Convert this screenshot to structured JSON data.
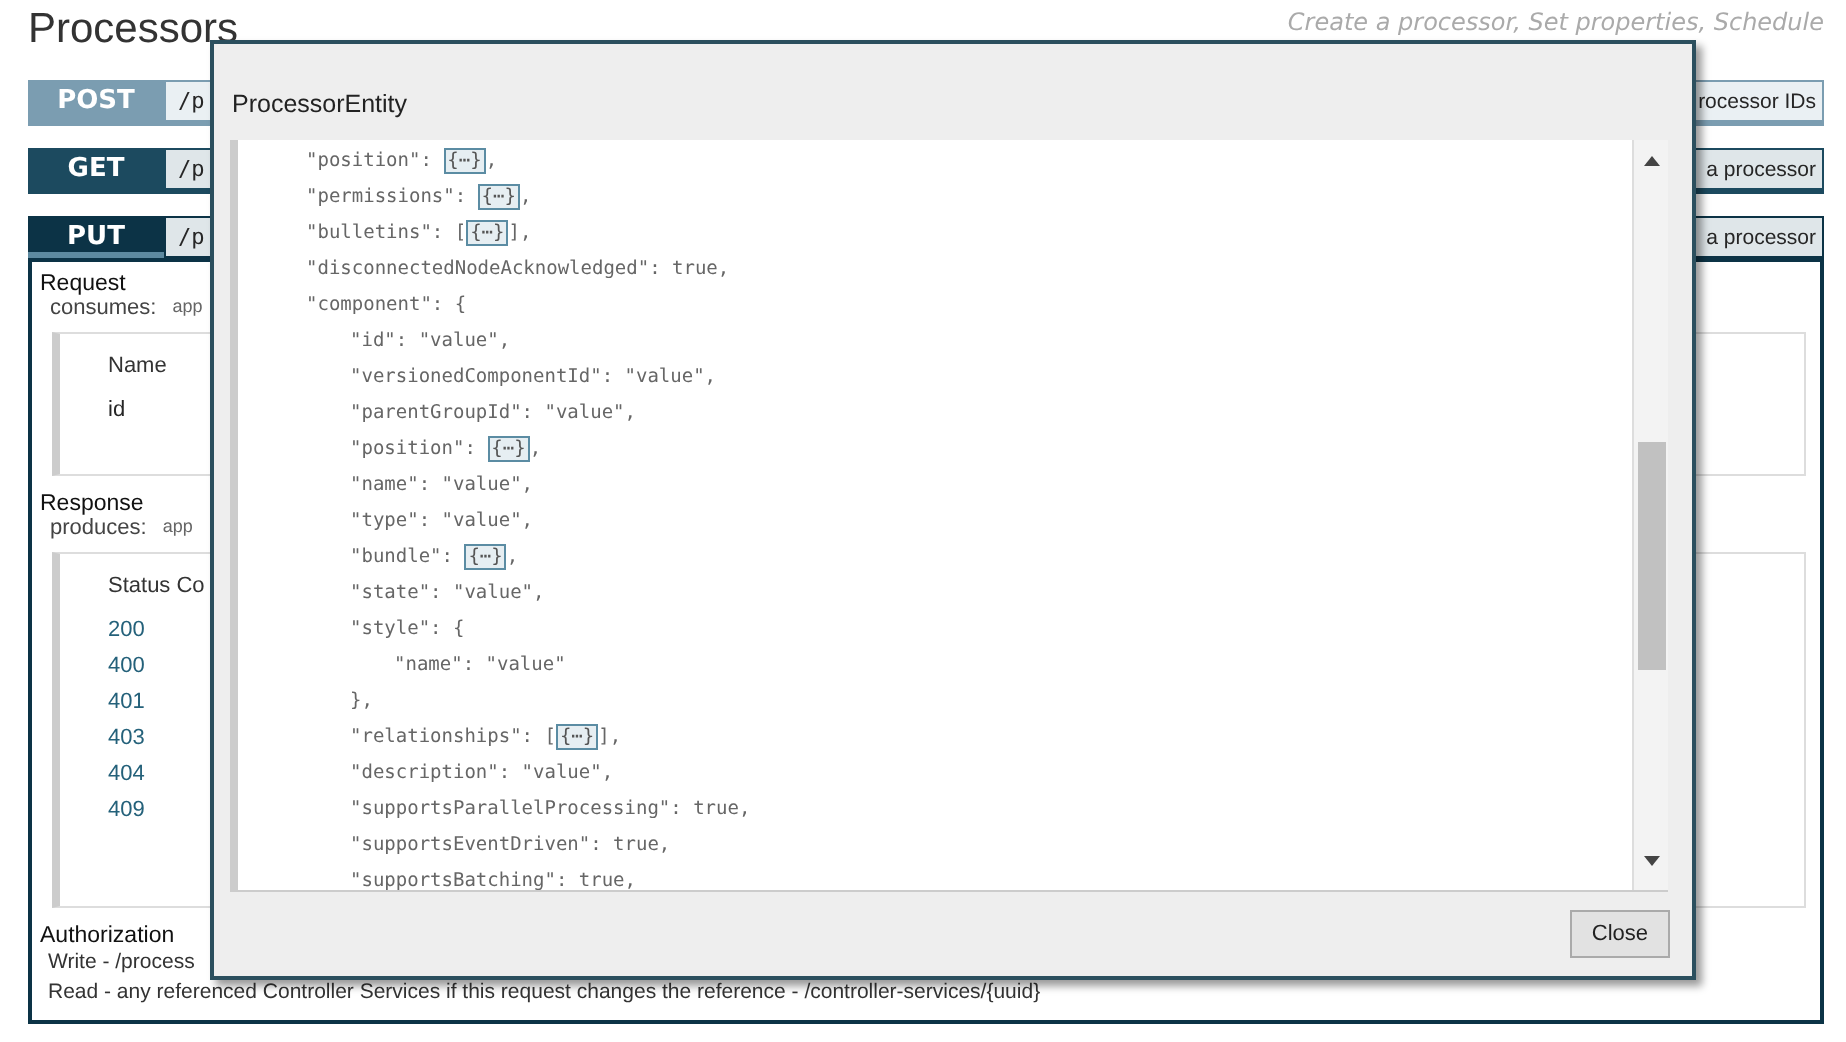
{
  "page": {
    "title": "Processors",
    "subtitle": "Create a processor, Set properties, Schedule"
  },
  "endpoints": [
    {
      "method": "POST",
      "path": "/p",
      "summary": "rocessor IDs",
      "expanded": false
    },
    {
      "method": "GET",
      "path": "/p",
      "summary": "a processor",
      "expanded": false
    },
    {
      "method": "PUT",
      "path": "/p",
      "summary": "a processor",
      "expanded": true
    }
  ],
  "details": {
    "request_heading": "Request",
    "consumes_label": "consumes:",
    "consumes_value": "app",
    "parameters": {
      "columns": [
        "Name"
      ],
      "rows": [
        "id"
      ]
    },
    "response_heading": "Response",
    "produces_label": "produces:",
    "produces_value": "app",
    "status_codes": {
      "columns": [
        "Status Co"
      ],
      "rows": [
        "200",
        "400",
        "401",
        "403",
        "404",
        "409"
      ]
    },
    "authorization_heading": "Authorization",
    "authorization_lines": [
      "Write - /process",
      "Read - any referenced Controller Services if this request changes the reference - /controller-services/{uuid}"
    ]
  },
  "dialog": {
    "title": "ProcessorEntity",
    "close_button": "Close",
    "lines": [
      {
        "text": "\"position\": ",
        "collapsed": "{⋯}",
        "suffix": ","
      },
      {
        "text": "\"permissions\": ",
        "collapsed": "{⋯}",
        "suffix": ","
      },
      {
        "text": "\"bulletins\": [",
        "collapsed": "{⋯}",
        "suffix": "],"
      },
      {
        "text": "\"disconnectedNodeAcknowledged\": true,"
      },
      {
        "text": "\"component\": {",
        "children": [
          {
            "text": "\"id\": \"value\","
          },
          {
            "text": "\"versionedComponentId\": \"value\","
          },
          {
            "text": "\"parentGroupId\": \"value\","
          },
          {
            "text": "\"position\": ",
            "collapsed": "{⋯}",
            "suffix": ","
          },
          {
            "text": "\"name\": \"value\","
          },
          {
            "text": "\"type\": \"value\","
          },
          {
            "text": "\"bundle\": ",
            "collapsed": "{⋯}",
            "suffix": ","
          },
          {
            "text": "\"state\": \"value\","
          },
          {
            "text": "\"style\": {",
            "children": [
              {
                "text": "\"name\": \"value\""
              }
            ]
          },
          {
            "text": "},"
          },
          {
            "text": "\"relationships\": [",
            "collapsed": "{⋯}",
            "suffix": "],"
          },
          {
            "text": "\"description\": \"value\","
          },
          {
            "text": "\"supportsParallelProcessing\": true,"
          },
          {
            "text": "\"supportsEventDriven\": true,"
          },
          {
            "text": "\"supportsBatching\": true,"
          }
        ]
      }
    ]
  }
}
